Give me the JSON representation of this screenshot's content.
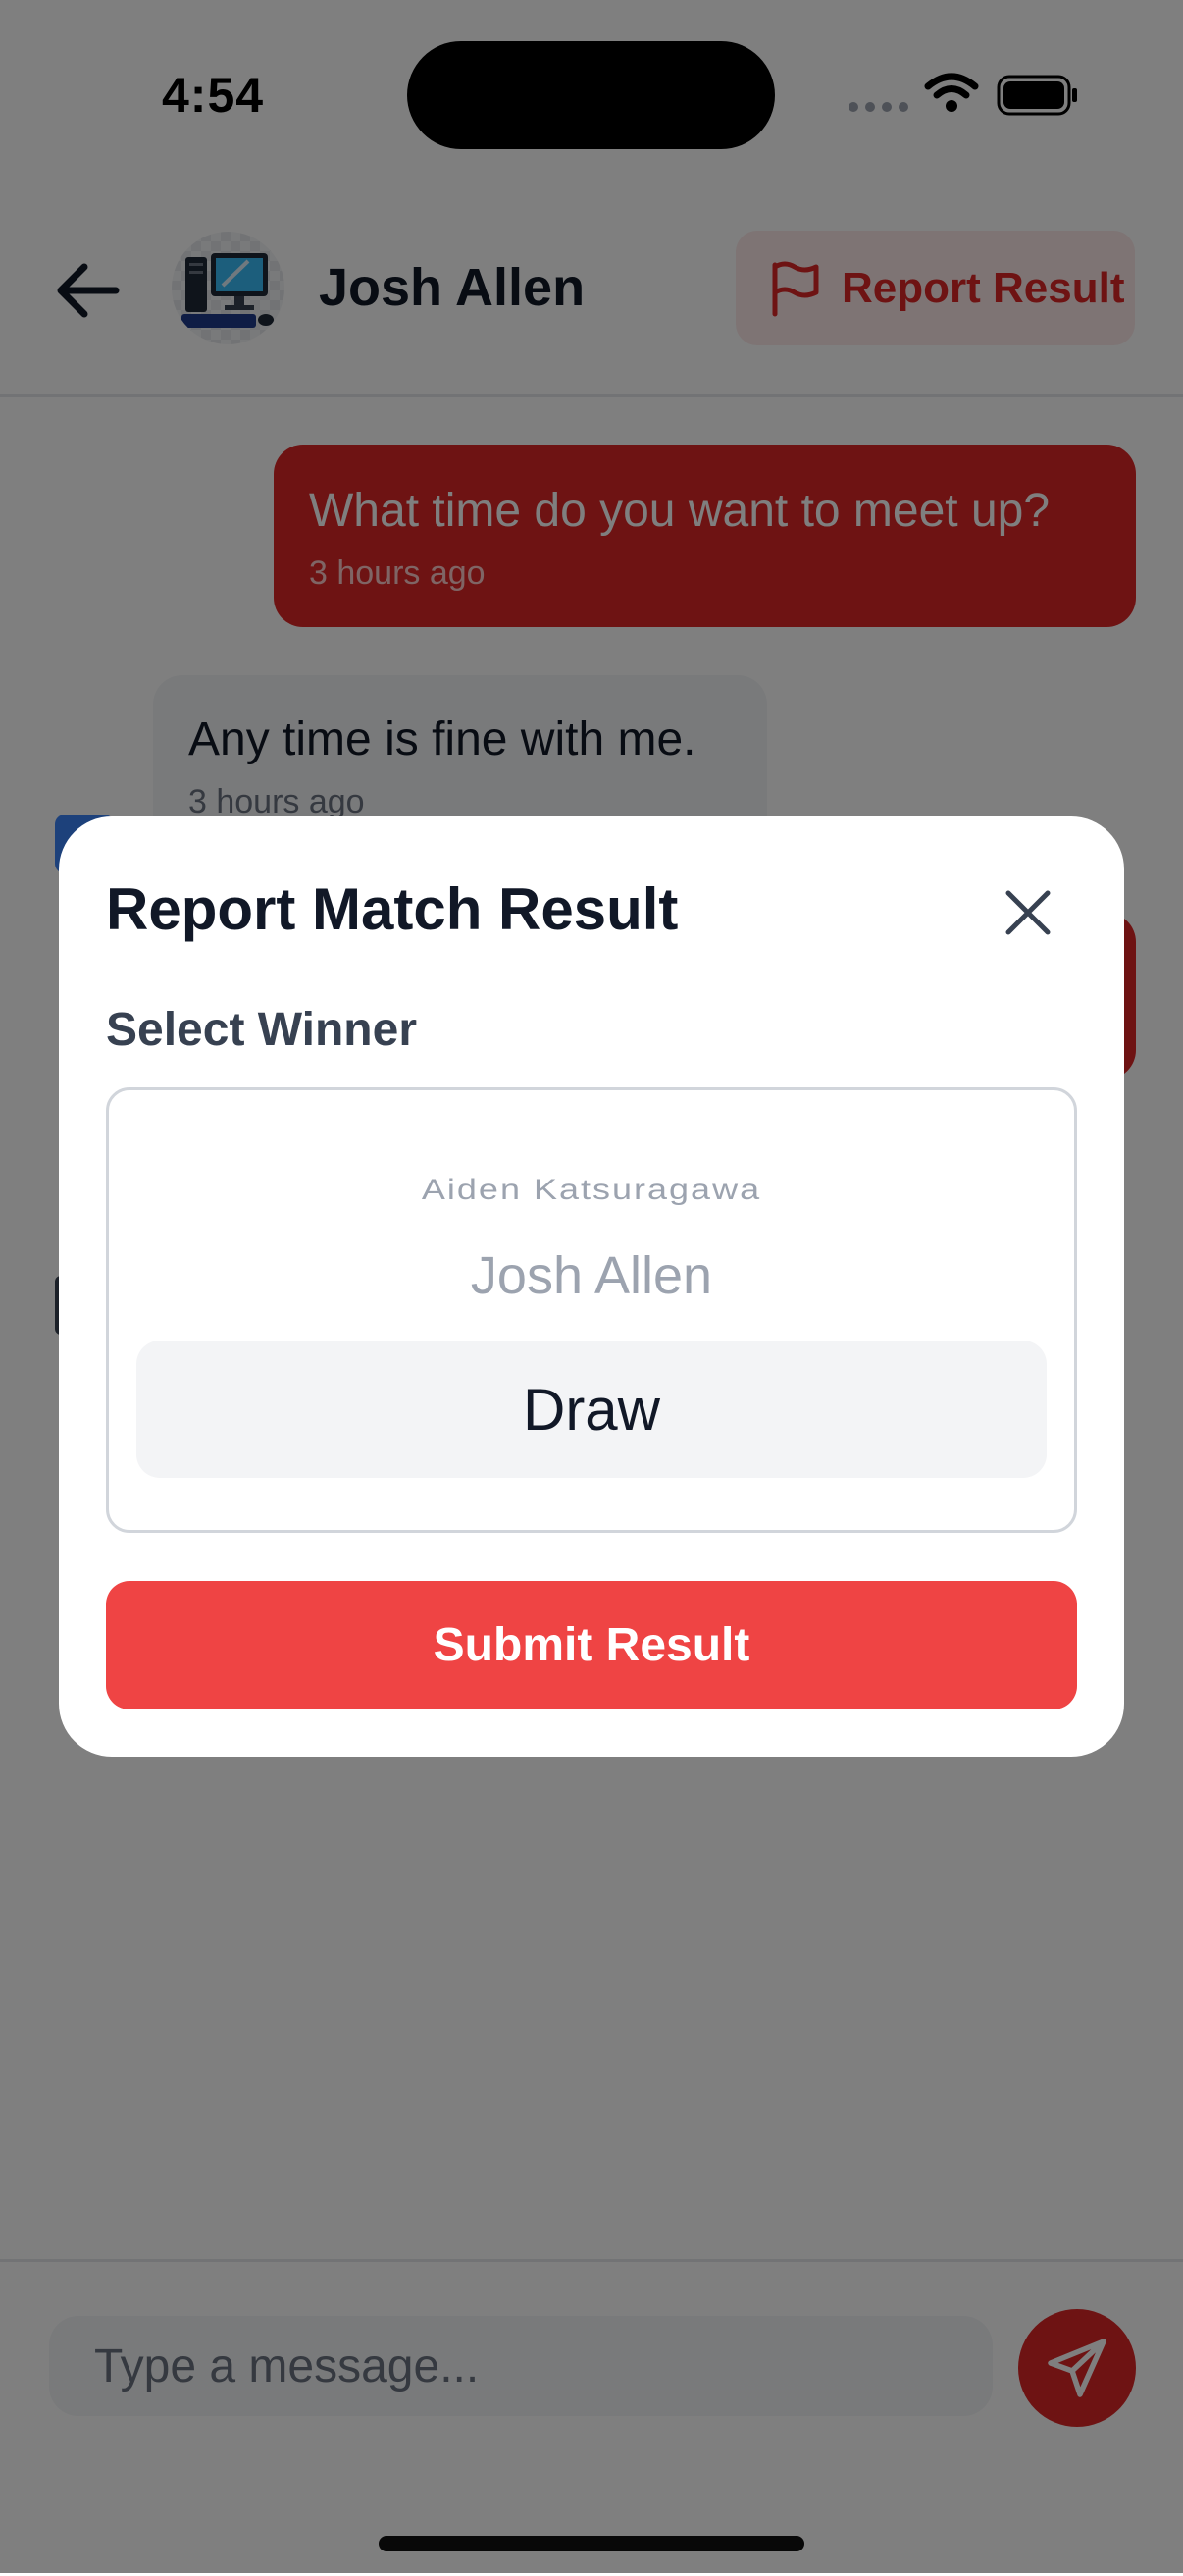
{
  "status_bar": {
    "time": "4:54",
    "icons": [
      "signal-dots-icon",
      "wifi-icon",
      "battery-icon"
    ]
  },
  "header": {
    "peer_name": "Josh Allen",
    "avatar_icon": "computer-icon",
    "report_button_label": "Report Result",
    "report_icon": "flag-icon",
    "back_icon": "arrow-left-icon"
  },
  "messages": [
    {
      "sender": "me",
      "text": "What time do you want to meet up?",
      "time": "3 hours ago"
    },
    {
      "sender": "them",
      "text": "Any time is fine with me.",
      "time": "3 hours ago"
    }
  ],
  "composer": {
    "placeholder": "Type a message...",
    "send_icon": "send-icon"
  },
  "modal": {
    "title": "Report Match Result",
    "close_icon": "close-icon",
    "select_label": "Select Winner",
    "options": [
      "Aiden Katsuragawa",
      "Josh Allen",
      "Draw"
    ],
    "selected": "Draw",
    "submit_label": "Submit Result"
  },
  "colors": {
    "accent": "#ef4444",
    "accent_dark": "#dc2626",
    "overlay": "rgba(0,0,0,0.5)"
  }
}
